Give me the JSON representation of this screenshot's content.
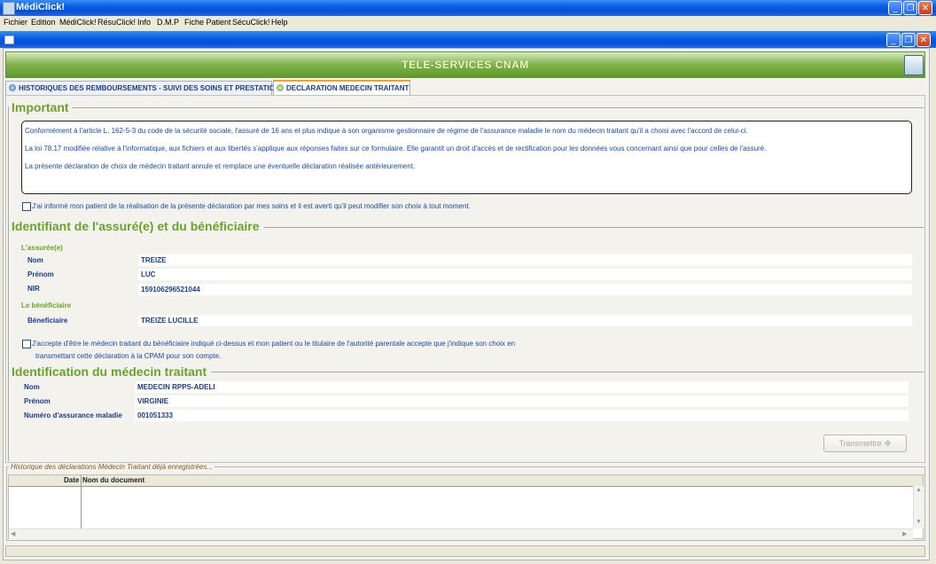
{
  "app": {
    "title": "MédiClick!"
  },
  "menu": [
    "Fichier",
    "Edition",
    "MédiClick!",
    "RésuClick!",
    "Info",
    "D.M.P",
    "Fiche Patient",
    "SécuClick!",
    "Help"
  ],
  "banner": {
    "title": "TELE-SERVICES CNAM"
  },
  "tabs": [
    {
      "label": "HISTORIQUES DES REMBOURSEMENTS - SUIVI DES SOINS ET PRESTATIONS",
      "active": false
    },
    {
      "label": "DECLARATION MEDECIN TRAITANT",
      "active": true
    }
  ],
  "important": {
    "title": "Important",
    "paragraphs": [
      "Conformément à l'article L. 162-5-3 du code de la sécurité sociale, l'assuré de 16 ans et plus indique à son organisme gestionnaire de régime de l'assurance maladie le nom du médecin traitant qu'il a choisi avec l'accord de celui-ci.",
      "La loi 78.17 modifiée relative à l'informatique, aux fichiers et aux libertés s'applique aux réponses faites sur ce formulaire. Elle garantit un droit d'accès et de rectification pour les données vous concernant ainsi que pour celles de l'assuré.",
      "La présente déclaration de choix de médecin traitant annule et remplace une éventuelle déclaration réalisée antérieurement."
    ],
    "checkbox_label": "J'ai informé mon patient de la réalisation de la présente déclaration par mes soins et il est averti qu'il peut modifier son choix à tout moment."
  },
  "identifiant": {
    "title": "Identifiant de l'assuré(e) et du bénéficiaire",
    "assure_heading": "L'assurée(e)",
    "fields": [
      {
        "label": "Nom",
        "value": "TREIZE"
      },
      {
        "label": "Prénom",
        "value": "LUC"
      },
      {
        "label": "NIR",
        "value": "159106296521044"
      }
    ],
    "beneficiaire_heading": "Le bénéficiaire",
    "beneficiaire": {
      "label": "Béneficiaire",
      "value": "TREIZE LUCILLE"
    },
    "checkbox_line1": "J'accepte d'être le médecin traitant du bénéficiaire indiqué ci-dessus et mon patient ou le titulaire de l'autorité parentale accepte que j'indique son choix en",
    "checkbox_line2": "transmettant cette déclaration à la CPAM pour son compte."
  },
  "medecin": {
    "title": "Identification du médecin traitant",
    "fields": [
      {
        "label": "Nom",
        "value": "MEDECIN RPPS-ADELI"
      },
      {
        "label": "Prénom",
        "value": "VIRGINIE"
      },
      {
        "label": "Numéro d'assurance maladie",
        "value": "001051333"
      }
    ]
  },
  "transmit_label": "Transmettre",
  "history": {
    "title": "Historique des déclarations Médecin Traitant déjà enregistrées...",
    "columns": [
      "Date",
      "Nom du document"
    ]
  },
  "icons": {
    "app": "app-icon",
    "minimize": "minimize-icon",
    "maximize": "restore-icon",
    "close": "close-icon",
    "banner": "device-icon",
    "transmit": "plus-icon"
  },
  "colors": {
    "accent_green": "#6aa32c",
    "text_blue": "#1a4aaa",
    "titlebar": "#0a5fe0"
  }
}
